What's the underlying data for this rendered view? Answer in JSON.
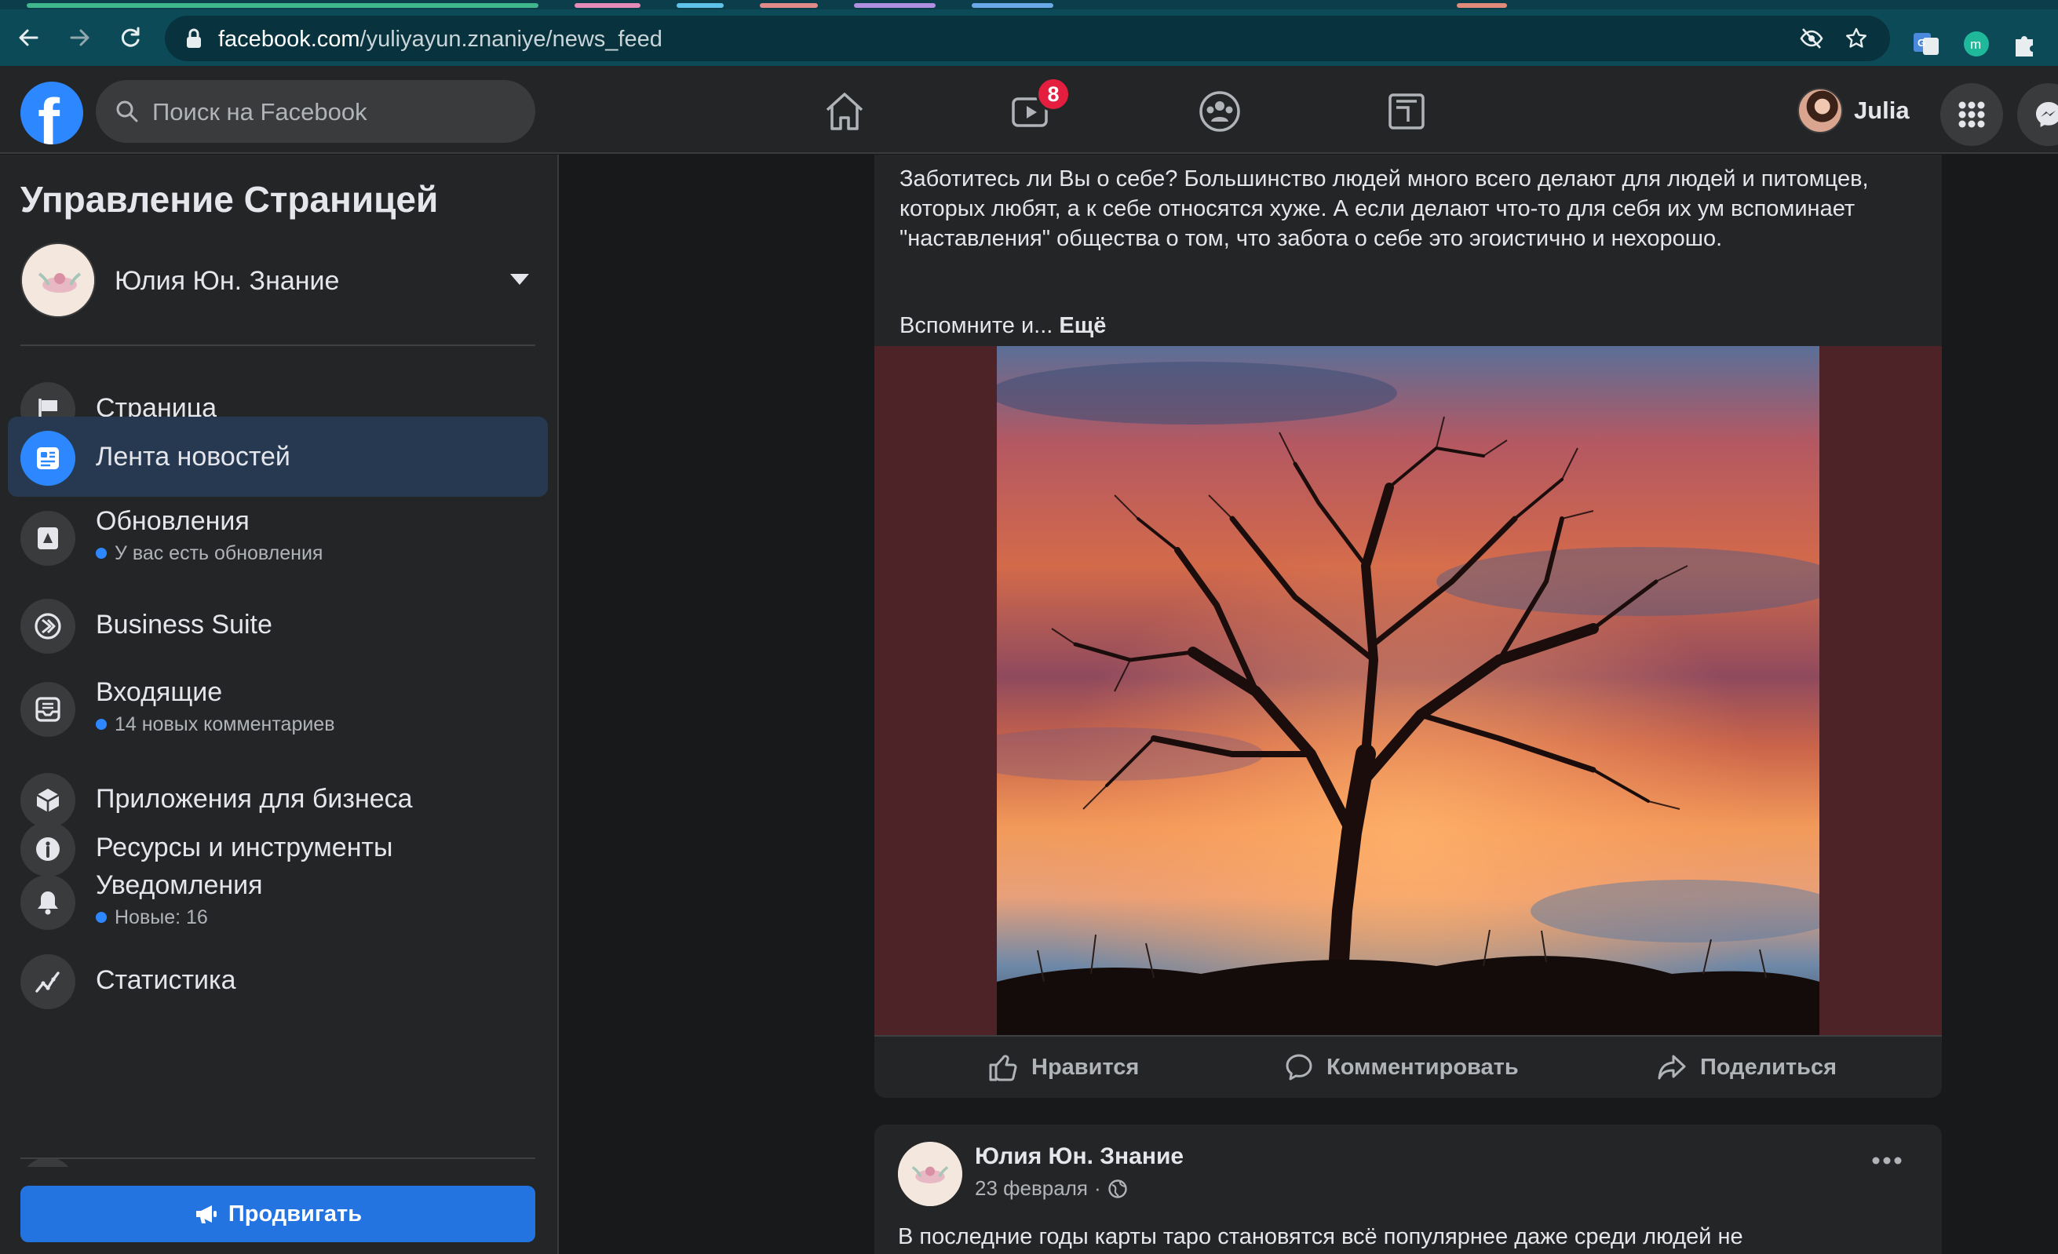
{
  "browser": {
    "url_host": "facebook.com",
    "url_path": "/yuliyayun.znaniye/news_feed"
  },
  "topbar": {
    "search_placeholder": "Поиск на Facebook",
    "watch_badge": "8",
    "user_name": "Julia",
    "colors": {
      "accent": "#2d88ff",
      "badge": "#e41e3f",
      "bar": "#242526"
    }
  },
  "sidebar": {
    "title": "Управление Страницей",
    "page_name": "Юлия Юн. Знание",
    "items": [
      {
        "label": "Страница",
        "icon": "flag-icon"
      },
      {
        "label": "Лента новостей",
        "icon": "news-feed-icon",
        "active": true
      },
      {
        "label": "Обновления",
        "sub": "У вас есть обновления",
        "icon": "updates-icon"
      },
      {
        "label": "Business Suite",
        "icon": "business-suite-icon"
      },
      {
        "label": "Входящие",
        "sub": "14 новых комментариев",
        "icon": "inbox-icon"
      },
      {
        "label": "Приложения для бизнеса",
        "icon": "cube-icon"
      },
      {
        "label": "Ресурсы и инструменты",
        "icon": "info-icon"
      },
      {
        "label": "Уведомления",
        "sub": "Новые: 16",
        "icon": "bell-icon"
      },
      {
        "label": "Статистика",
        "icon": "stats-icon"
      }
    ],
    "promote_label": "Продвигать"
  },
  "feed": {
    "post1": {
      "text": "Заботитесь ли Вы о себе? Большинство людей много всего делают для людей и питомцев, которых любят, а к себе относятся хуже. А если делают что-то для себя их ум вспоминает \"наставления\" общества о том, что забота о себе это эгоистично и нехорошо.",
      "more_prefix": "Вспомните и...",
      "more_link": "Ещё",
      "actions": {
        "like": "Нравится",
        "comment": "Комментировать",
        "share": "Поделиться"
      }
    },
    "post2": {
      "author": "Юлия Юн. Знание",
      "date": "23 февраля",
      "separator": "·",
      "text": "В последние годы карты таро становятся всё популярнее даже среди людей не"
    }
  }
}
